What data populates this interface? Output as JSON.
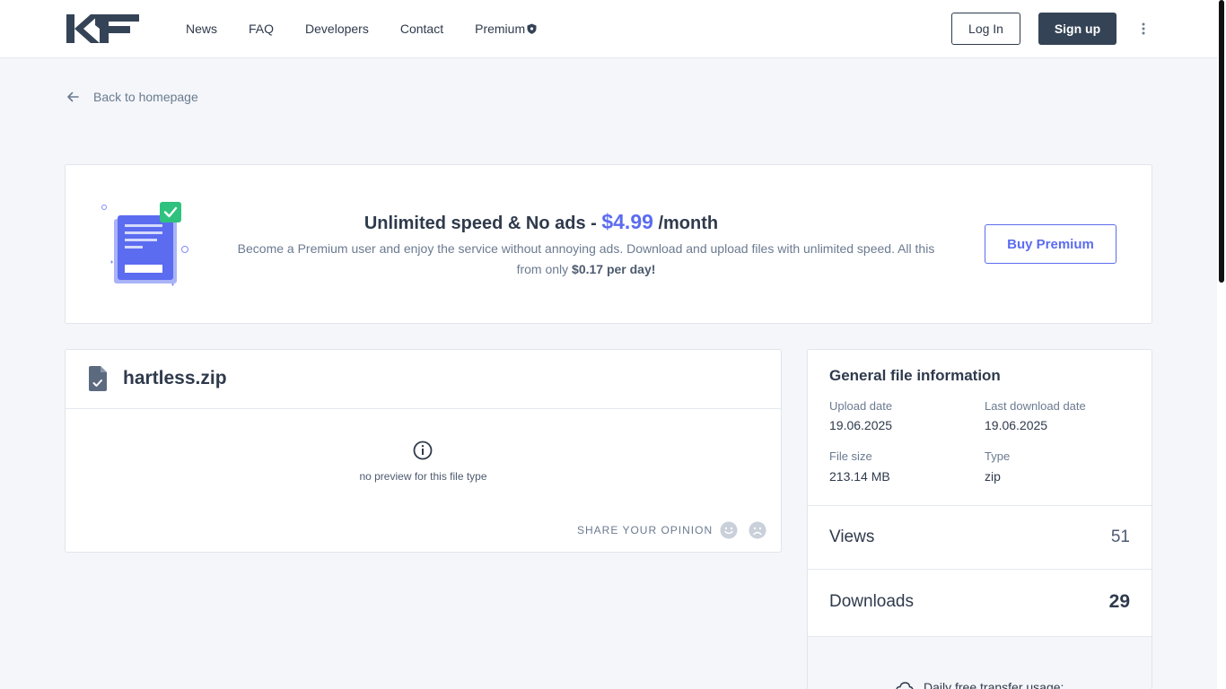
{
  "header": {
    "logo_text": "KF",
    "nav": [
      "News",
      "FAQ",
      "Developers",
      "Contact",
      "Premium"
    ],
    "login_label": "Log In",
    "signup_label": "Sign up"
  },
  "back_link": "Back to homepage",
  "banner": {
    "title_prefix": "Unlimited speed & No ads - ",
    "price": "$4.99",
    "title_suffix": " /month",
    "text_main": "Become a Premium user and enjoy the service without annoying ads. Download and upload files with unlimited speed. All this from only ",
    "text_bold": "$0.17 per day!",
    "button_label": "Buy Premium"
  },
  "file": {
    "name": "hartless.zip",
    "no_preview": "no preview for this file type",
    "share_label": "SHARE YOUR OPINION"
  },
  "info": {
    "title": "General file information",
    "upload_date_label": "Upload date",
    "upload_date": "19.06.2025",
    "last_download_label": "Last download date",
    "last_download": "19.06.2025",
    "file_size_label": "File size",
    "file_size": "213.14 MB",
    "type_label": "Type",
    "type": "zip",
    "views_label": "Views",
    "views": "51",
    "downloads_label": "Downloads",
    "downloads": "29",
    "transfer_label": "Daily free transfer usage:"
  },
  "colors": {
    "accent": "#5b6cf0",
    "dark": "#354356",
    "check_green": "#2ec27e"
  }
}
